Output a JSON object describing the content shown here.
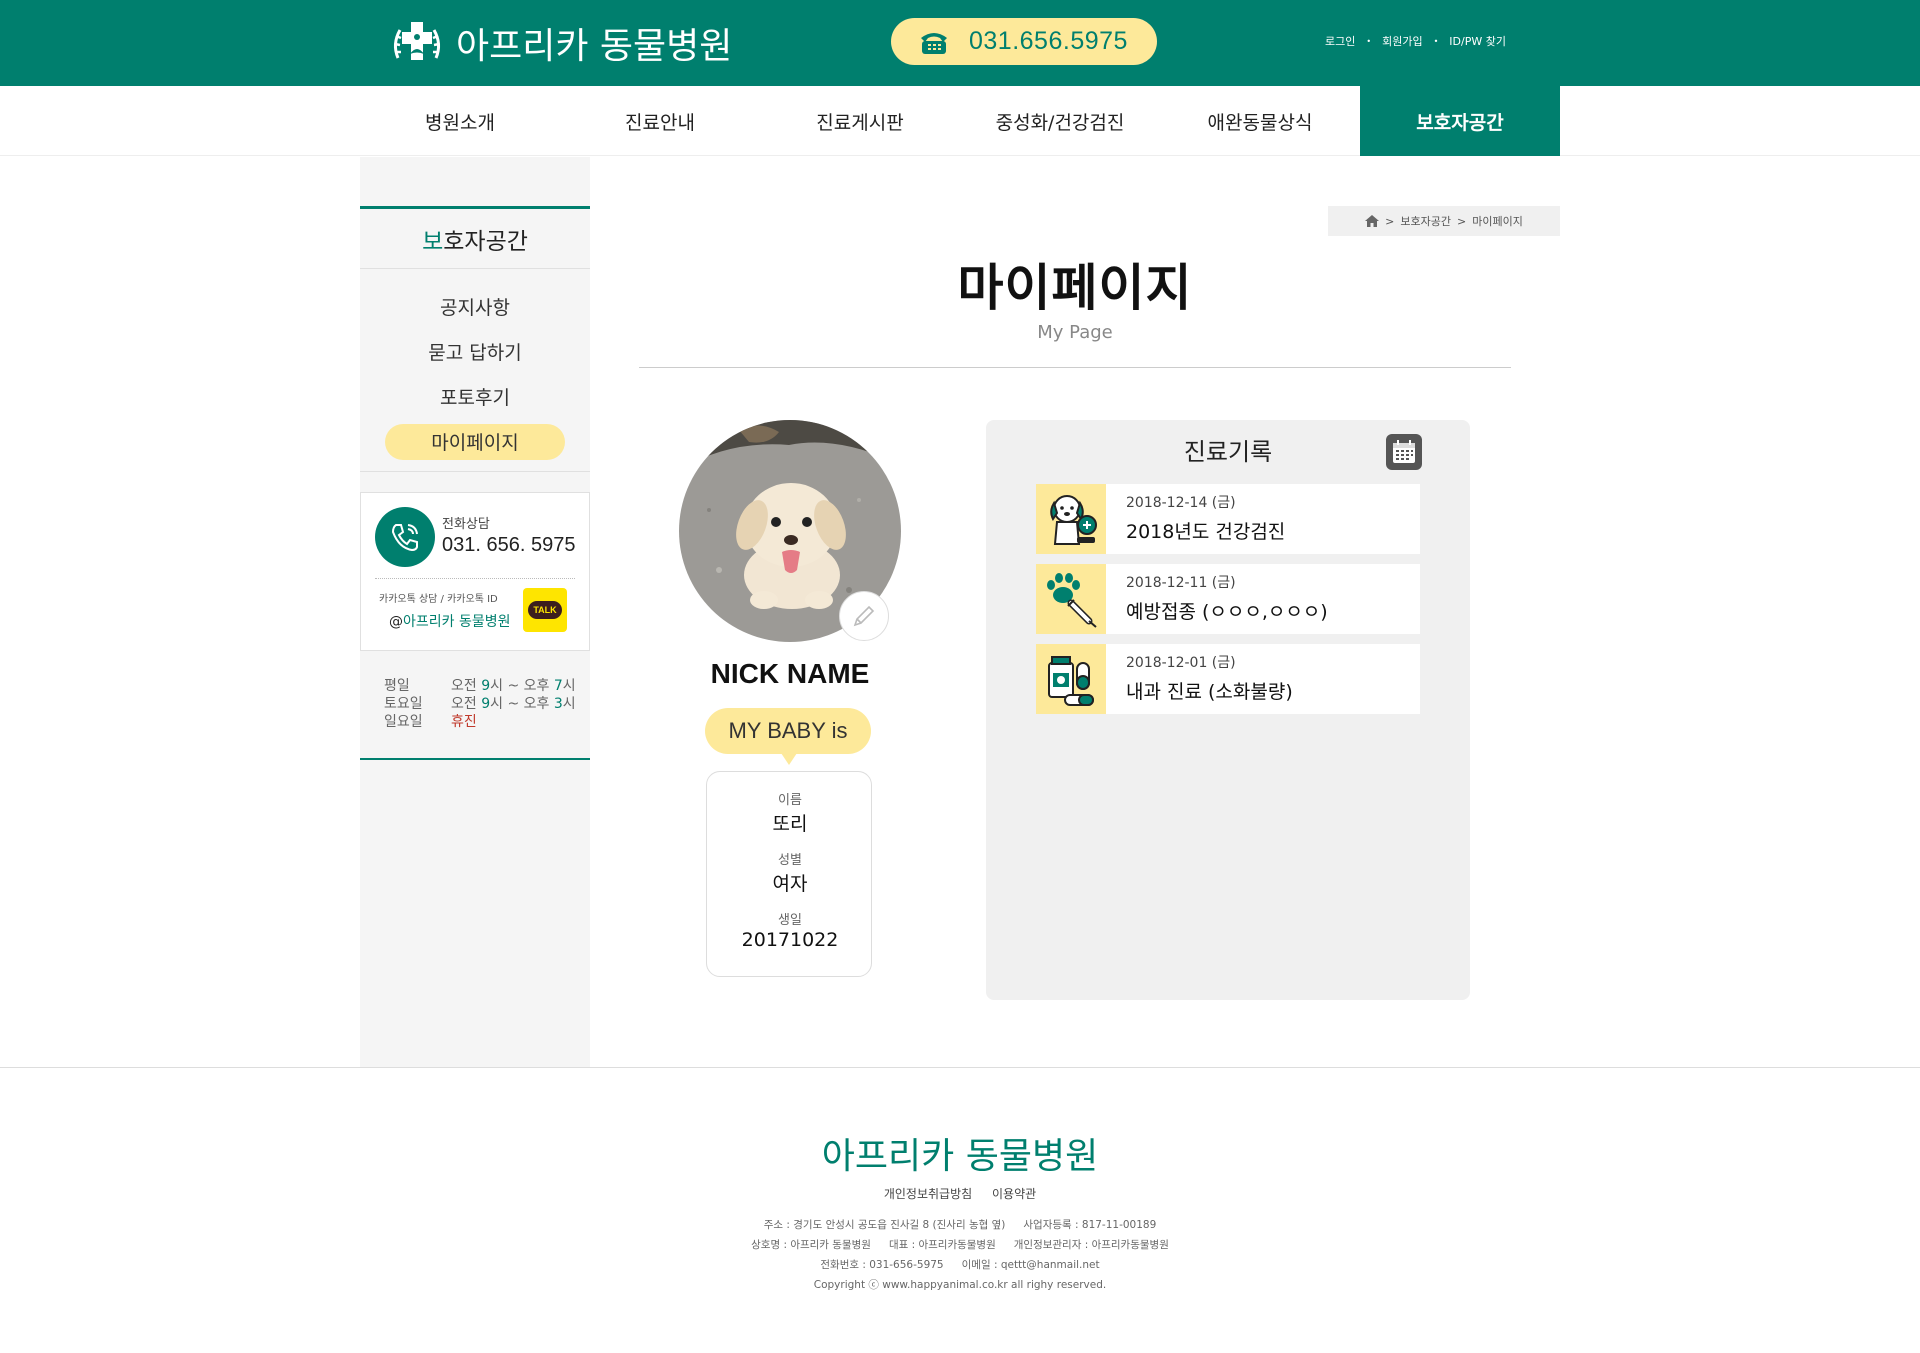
{
  "header": {
    "logo_text": "아프리카 동물병원",
    "phone": "031.656.5975",
    "links": [
      "로그인",
      "회원가입",
      "ID/PW 찾기"
    ]
  },
  "nav": {
    "items": [
      "병원소개",
      "진료안내",
      "진료게시판",
      "중성화/건강검진",
      "애완동물상식",
      "보호자공간"
    ],
    "active": "보호자공간"
  },
  "sidebar": {
    "title_accent": "보",
    "title_rest": "호자공간",
    "menu": [
      "공지사항",
      "묻고 답하기",
      "포토후기",
      "마이페이지"
    ],
    "active": "마이페이지",
    "contact": {
      "label": "전화상담",
      "number": "031. 656. 5975",
      "kakao_label": "카카오톡 상담 / 카카오톡 ID",
      "kakao_at": "@",
      "kakao_id": "아프리카 동물병원",
      "kakao_badge": "TALK"
    },
    "hours": [
      {
        "day": "평일",
        "from_pre": "오전 ",
        "from_num": "9",
        "from_post": "시 ~ 오후 ",
        "to_num": "7",
        "to_post": "시"
      },
      {
        "day": "토요일",
        "from_pre": "오전 ",
        "from_num": "9",
        "from_post": "시 ~ 오후 ",
        "to_num": "3",
        "to_post": "시"
      },
      {
        "day": "일요일",
        "closed": "휴진"
      }
    ]
  },
  "breadcrumb": [
    "보호자공간",
    "마이페이지"
  ],
  "breadcrumb_sep": ">",
  "page": {
    "title": "마이페이지",
    "subtitle": "My Page"
  },
  "profile": {
    "nickname": "NICK NAME",
    "baby_label": "MY BABY is",
    "fields": [
      {
        "label": "이름",
        "value": "또리"
      },
      {
        "label": "성별",
        "value": "여자"
      },
      {
        "label": "생일",
        "value": "20171022"
      }
    ]
  },
  "records": {
    "title": "진료기록",
    "items": [
      {
        "date": "2018-12-14 (금)",
        "title": "2018년도 건강검진",
        "icon": "dog-checkup-icon"
      },
      {
        "date": "2018-12-11 (금)",
        "title": "예방접종 (ㅇㅇㅇ,ㅇㅇㅇ)",
        "icon": "paw-syringe-icon"
      },
      {
        "date": "2018-12-01 (금)",
        "title": "내과 진료 (소화불량)",
        "icon": "medicine-icon"
      }
    ]
  },
  "footer": {
    "name": "아프리카 동물병원",
    "links": [
      "개인정보취급방침",
      "이용약관"
    ],
    "lines": [
      [
        "주소 : 경기도 안성시 공도읍 진사길 8 (진사리 농협 옆)",
        "사업자등록 : 817-11-00189"
      ],
      [
        "상호명 : 아프리카 동물병원",
        "대표 : 아프리카동물병원",
        "개인정보관리자 : 아프리카동물병원"
      ],
      [
        "전화번호 : 031-656-5975",
        "이메일 : qettt@hanmail.net"
      ],
      [
        "Copyright ⓒ www.happyanimal.co.kr all righy reserved."
      ]
    ]
  },
  "colors": {
    "brand": "#007f6e",
    "accent_yellow": "#fde99a",
    "closed": "#c0392b"
  }
}
